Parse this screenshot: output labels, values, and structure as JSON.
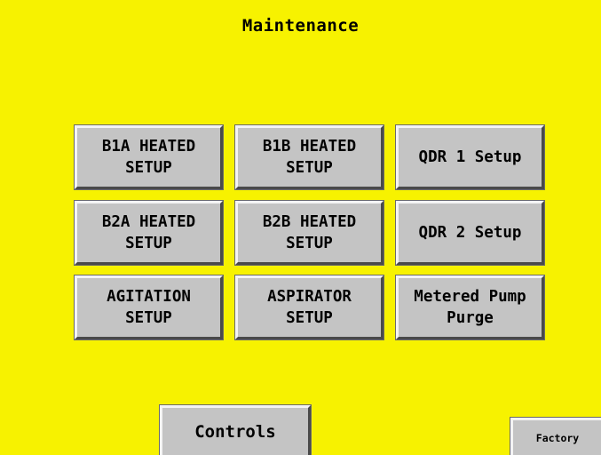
{
  "screen": {
    "title": "Maintenance"
  },
  "buttons": {
    "b1a": "B1A HEATED\nSETUP",
    "b1b": "B1B HEATED\nSETUP",
    "qdr1": "QDR 1 Setup",
    "b2a": "B2A HEATED\nSETUP",
    "b2b": "B2B HEATED\nSETUP",
    "qdr2": "QDR 2 Setup",
    "agitation": "AGITATION\nSETUP",
    "aspirator": "ASPIRATOR\nSETUP",
    "metered": "Metered Pump\nPurge",
    "controls": "Controls",
    "factory": "Factory"
  },
  "colors": {
    "background": "#f7f200",
    "button_face": "#c4c4c4"
  }
}
